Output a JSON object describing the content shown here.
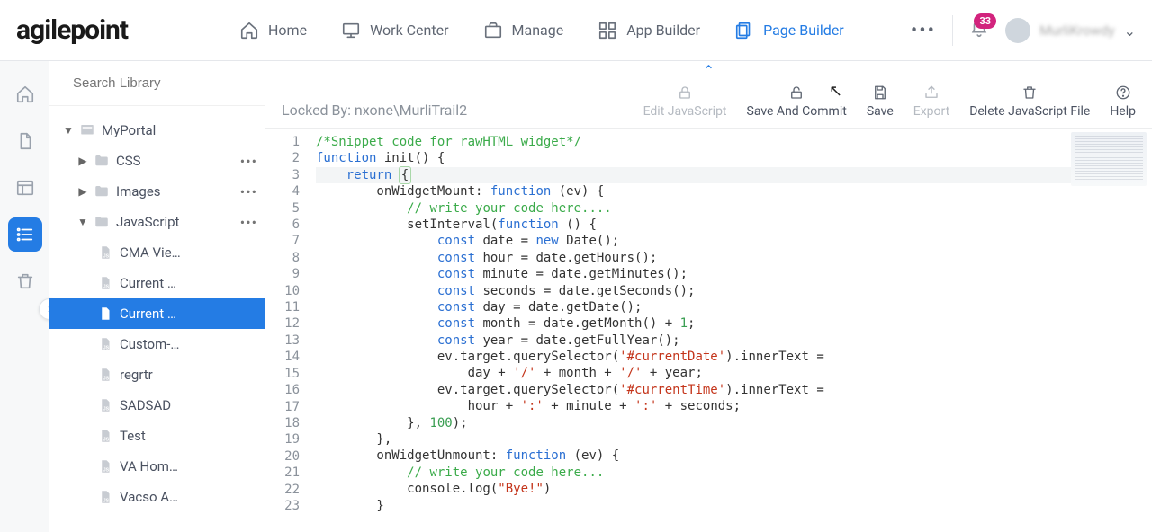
{
  "brand": {
    "name": "agilepoint"
  },
  "nav": {
    "items": [
      {
        "label": "Home",
        "icon": "home-icon",
        "active": false
      },
      {
        "label": "Work Center",
        "icon": "monitor-icon",
        "active": false
      },
      {
        "label": "Manage",
        "icon": "briefcase-icon",
        "active": false
      },
      {
        "label": "App Builder",
        "icon": "grid-icon",
        "active": false
      },
      {
        "label": "Page Builder",
        "icon": "pages-icon",
        "active": true
      }
    ],
    "badge_count": "33",
    "username": "MurliKrowdy"
  },
  "leftRail": [
    {
      "name": "home",
      "active": false
    },
    {
      "name": "document",
      "active": false
    },
    {
      "name": "layout",
      "active": false
    },
    {
      "name": "list",
      "active": true
    },
    {
      "name": "trash",
      "active": false
    }
  ],
  "search": {
    "placeholder": "Search Library"
  },
  "tree": {
    "root": {
      "label": "MyPortal",
      "expanded": true
    },
    "folders": [
      {
        "label": "CSS",
        "expanded": false,
        "more": true
      },
      {
        "label": "Images",
        "expanded": false,
        "more": true
      },
      {
        "label": "JavaScript",
        "expanded": true,
        "more": true,
        "files": [
          {
            "label": "CMA Vie…",
            "selected": false
          },
          {
            "label": "Current …",
            "selected": false
          },
          {
            "label": "Current …",
            "selected": true
          },
          {
            "label": "Custom-…",
            "selected": false
          },
          {
            "label": "regrtr",
            "selected": false
          },
          {
            "label": "SADSAD",
            "selected": false
          },
          {
            "label": "Test",
            "selected": false
          },
          {
            "label": "VA Hom…",
            "selected": false
          },
          {
            "label": "Vacso A…",
            "selected": false
          }
        ]
      }
    ]
  },
  "toolbar": {
    "locked_by": "Locked By: nxone\\MurliTrail2",
    "actions": [
      {
        "id": "edit-js",
        "label": "Edit JavaScript",
        "icon": "lock-icon",
        "disabled": true
      },
      {
        "id": "save-commit",
        "label": "Save And Commit",
        "icon": "lock-open-icon",
        "disabled": false
      },
      {
        "id": "save",
        "label": "Save",
        "icon": "save-icon",
        "disabled": false
      },
      {
        "id": "export",
        "label": "Export",
        "icon": "export-icon",
        "disabled": true
      },
      {
        "id": "delete",
        "label": "Delete JavaScript File",
        "icon": "trash-icon",
        "disabled": false
      },
      {
        "id": "help",
        "label": "Help",
        "icon": "help-icon",
        "disabled": false
      }
    ]
  },
  "code": {
    "highlight_line": 3,
    "lines": [
      [
        [
          "c-comment",
          "/*Snippet code for rawHTML widget*/"
        ]
      ],
      [
        [
          "c-kw",
          "function"
        ],
        [
          "",
          " init() {"
        ]
      ],
      [
        [
          "",
          "    "
        ],
        [
          "c-kw",
          "return"
        ],
        [
          "",
          " "
        ],
        [
          "hl-box",
          "{"
        ]
      ],
      [
        [
          "",
          "        onWidgetMount: "
        ],
        [
          "c-kw",
          "function"
        ],
        [
          "",
          " (ev) {"
        ]
      ],
      [
        [
          "",
          "            "
        ],
        [
          "c-comment",
          "// write your code here...."
        ]
      ],
      [
        [
          "",
          "            setInterval("
        ],
        [
          "c-kw",
          "function"
        ],
        [
          "",
          " () {"
        ]
      ],
      [
        [
          "",
          "                "
        ],
        [
          "c-kw",
          "const"
        ],
        [
          "",
          " date = "
        ],
        [
          "c-kw",
          "new"
        ],
        [
          "",
          " Date();"
        ]
      ],
      [
        [
          "",
          "                "
        ],
        [
          "c-kw",
          "const"
        ],
        [
          "",
          " hour = date.getHours();"
        ]
      ],
      [
        [
          "",
          "                "
        ],
        [
          "c-kw",
          "const"
        ],
        [
          "",
          " minute = date.getMinutes();"
        ]
      ],
      [
        [
          "",
          "                "
        ],
        [
          "c-kw",
          "const"
        ],
        [
          "",
          " seconds = date.getSeconds();"
        ]
      ],
      [
        [
          "",
          "                "
        ],
        [
          "c-kw",
          "const"
        ],
        [
          "",
          " day = date.getDate();"
        ]
      ],
      [
        [
          "",
          "                "
        ],
        [
          "c-kw",
          "const"
        ],
        [
          "",
          " month = date.getMonth() + "
        ],
        [
          "c-num",
          "1"
        ],
        [
          "",
          ";"
        ]
      ],
      [
        [
          "",
          "                "
        ],
        [
          "c-kw",
          "const"
        ],
        [
          "",
          " year = date.getFullYear();"
        ]
      ],
      [
        [
          "",
          "                ev.target.querySelector("
        ],
        [
          "c-str",
          "'#currentDate'"
        ],
        [
          "",
          ").innerText ="
        ]
      ],
      [
        [
          "",
          "                    day + "
        ],
        [
          "c-str",
          "'/'"
        ],
        [
          "",
          " + month + "
        ],
        [
          "c-str",
          "'/'"
        ],
        [
          "",
          " + year;"
        ]
      ],
      [
        [
          "",
          "                ev.target.querySelector("
        ],
        [
          "c-str",
          "'#currentTime'"
        ],
        [
          "",
          ").innerText ="
        ]
      ],
      [
        [
          "",
          "                    hour + "
        ],
        [
          "c-str",
          "':'"
        ],
        [
          "",
          " + minute + "
        ],
        [
          "c-str",
          "':'"
        ],
        [
          "",
          " + seconds;"
        ]
      ],
      [
        [
          "",
          "            }, "
        ],
        [
          "c-num",
          "100"
        ],
        [
          "",
          ");"
        ]
      ],
      [
        [
          "",
          "        },"
        ]
      ],
      [
        [
          "",
          "        onWidgetUnmount: "
        ],
        [
          "c-kw",
          "function"
        ],
        [
          "",
          " (ev) {"
        ]
      ],
      [
        [
          "",
          "            "
        ],
        [
          "c-comment",
          "// write your code here..."
        ]
      ],
      [
        [
          "",
          "            console.log("
        ],
        [
          "c-str",
          "\"Bye!\""
        ],
        [
          "",
          ")"
        ]
      ],
      [
        [
          "",
          "        }"
        ]
      ]
    ]
  }
}
